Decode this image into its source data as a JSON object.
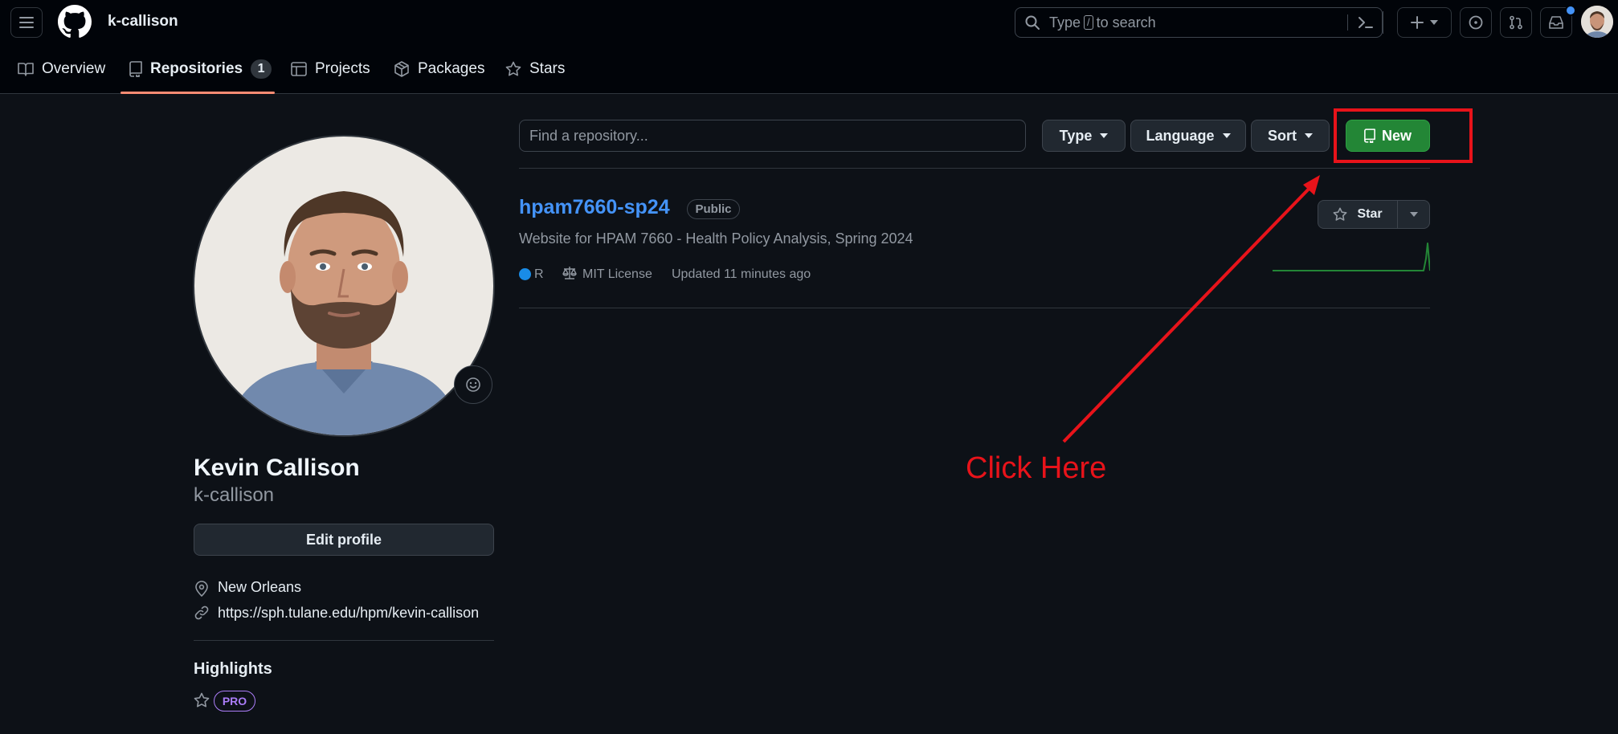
{
  "header": {
    "username": "k-callison",
    "search_placeholder": "Type / to search",
    "search_prefix": "Type",
    "search_key": "/",
    "search_suffix": "to search"
  },
  "tabs": [
    {
      "label": "Overview",
      "icon": "book-icon"
    },
    {
      "label": "Repositories",
      "icon": "repo-icon",
      "count": "1",
      "active": true
    },
    {
      "label": "Projects",
      "icon": "table-icon"
    },
    {
      "label": "Packages",
      "icon": "package-icon"
    },
    {
      "label": "Stars",
      "icon": "star-icon"
    }
  ],
  "repo_filter": {
    "placeholder": "Find a repository...",
    "type_label": "Type",
    "language_label": "Language",
    "sort_label": "Sort",
    "new_label": "New"
  },
  "repo": {
    "name": "hpam7660-sp24",
    "visibility": "Public",
    "description": "Website for HPAM 7660 - Health Policy Analysis, Spring 2024",
    "language": "R",
    "language_color": "#198ce7",
    "license": "MIT License",
    "updated": "Updated 11 minutes ago",
    "star_label": "Star"
  },
  "profile": {
    "name": "Kevin Callison",
    "login": "k-callison",
    "edit_label": "Edit profile",
    "location": "New Orleans",
    "website": "https://sph.tulane.edu/hpm/kevin-callison",
    "highlights_title": "Highlights",
    "pro_label": "PRO"
  },
  "annotation": {
    "text": "Click Here",
    "color": "#e8131a"
  },
  "colors": {
    "accent_green": "#238636",
    "link_blue": "#4493f8",
    "tab_underline": "#fd8c73",
    "pro_purple": "#ab7df8"
  }
}
